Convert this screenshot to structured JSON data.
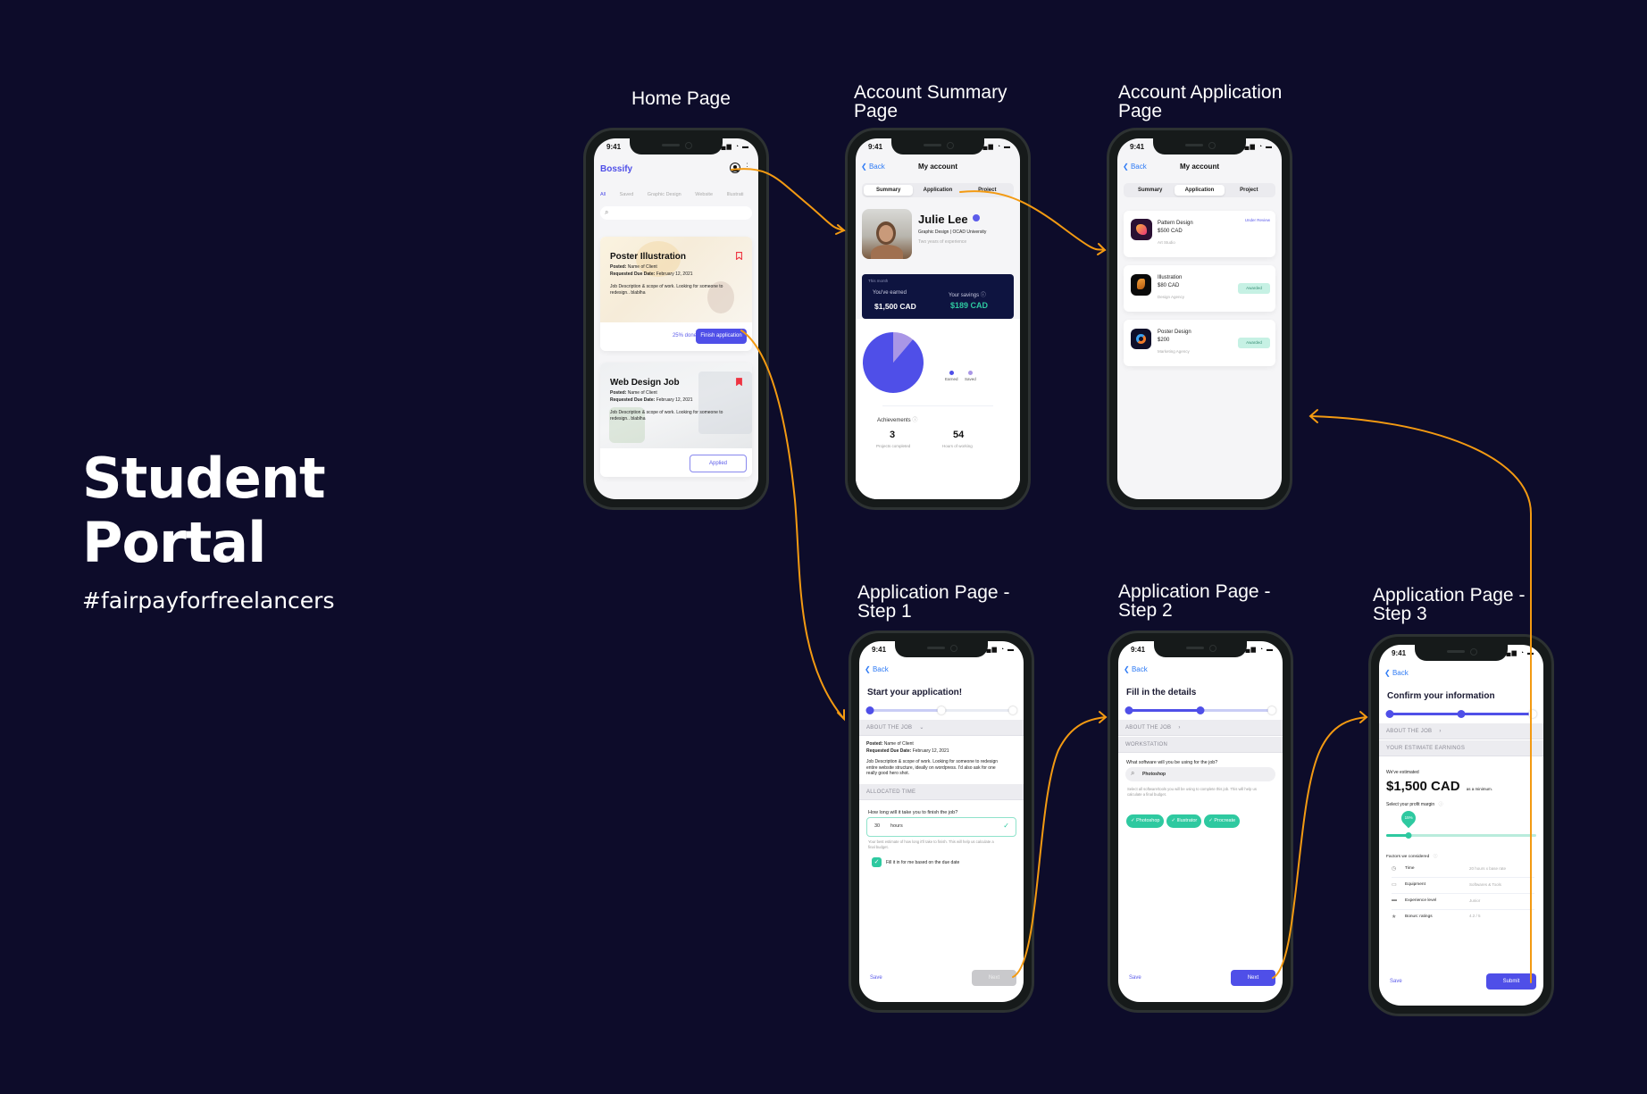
{
  "hero": {
    "title_line1": "Student",
    "title_line2": "Portal",
    "hashtag": "#fairpayforfreelancers"
  },
  "screen_titles": {
    "home": "Home Page",
    "summary_line1": "Account Summary",
    "summary_line2": "Page",
    "application_line1": "Account Application",
    "application_line2": "Page",
    "step1_line1": "Application Page -",
    "step1_line2": "Step 1",
    "step2_line1": "Application Page -",
    "step2_line2": "Step 2",
    "step3_line1": "Application Page -",
    "step3_line2": "Step 3"
  },
  "status_bar": {
    "time": "9:41",
    "icons": "signal-wifi-battery"
  },
  "colors": {
    "background": "#0d0c2a",
    "accent": "#4f4fe8",
    "teal": "#2ec9a0",
    "arrow": "#f39a12",
    "bookmark": "#ee3340"
  },
  "home": {
    "brand": "Bossify",
    "profile_icon": "user-circle-icon",
    "more_icon": "more-vertical-icon",
    "filters": [
      "All",
      "Saved",
      "Graphic Design",
      "Website",
      "Illustrati"
    ],
    "search_placeholder": "",
    "jobs": [
      {
        "title": "Poster Illustration",
        "posted_label": "Posted:",
        "posted_value": "Name of Client",
        "due_label": "Requested Due Date:",
        "due_value": "February 12, 2021",
        "description": "Job Description & scope of work. Looking for someone to redesign.. blablha",
        "bookmarked": false,
        "progress_text": "25% done",
        "action": "Finish application"
      },
      {
        "title": "Web Design Job",
        "posted_label": "Posted:",
        "posted_value": "Name of Client",
        "due_label": "Requested Due Date:",
        "due_value": "February 12, 2021",
        "description": "Job Description & scope of work. Looking for someone to redesign.. blablha",
        "bookmarked": true,
        "action": "Applied"
      }
    ]
  },
  "account": {
    "back": "Back",
    "title": "My account",
    "tabs": [
      "Summary",
      "Application",
      "Project"
    ]
  },
  "summary": {
    "name": "Julie Lee",
    "subtitle": "Graphic Design | OCAD University",
    "experience": "Two years of experience",
    "period": "This month",
    "earned_label": "You've earned",
    "earned_value": "$1,500 CAD",
    "savings_label": "Your savings",
    "savings_value": "$189 CAD",
    "legend": [
      "Earned",
      "Saved"
    ],
    "achievements_label": "Achievements",
    "projects_value": "3",
    "projects_label": "Projects completed",
    "hours_value": "54",
    "hours_label": "Hours of working"
  },
  "chart_data": {
    "type": "pie",
    "title": "",
    "categories": [
      "Earned",
      "Saved"
    ],
    "values": [
      1500,
      189
    ],
    "colors": [
      "#4f4fe8",
      "#a996e6"
    ],
    "legend": "right"
  },
  "applications": [
    {
      "title": "Pattern Design",
      "amount": "$500 CAD",
      "company": "Art Studio",
      "status": "Under Review",
      "status_type": "link"
    },
    {
      "title": "Illustration",
      "amount": "$80 CAD",
      "company": "Design Agency",
      "status": "Awarded",
      "status_type": "badge"
    },
    {
      "title": "Poster Design",
      "amount": "$200",
      "company": "Marketing Agency",
      "status": "Awarded",
      "status_type": "badge"
    }
  ],
  "step1": {
    "back": "Back",
    "heading": "Start your application!",
    "progress_step": 1,
    "progress_total": 3,
    "section_about": "ABOUT THE JOB",
    "posted_label": "Posted:",
    "posted_value": "Name of Client",
    "due_label": "Requested Due Date:",
    "due_value": "February 12, 2021",
    "description": "Job Description & scope of work. Looking for someone to redesign entire website structure, ideally on wordpress. I'd also ask for one really good hero shot.",
    "section_time": "ALLOCATED TIME",
    "question": "How long will it take you to finish the job?",
    "hours_value": "30",
    "hours_unit": "hours",
    "helper": "Your best estimate of how long it'll take to finish. This will help us calculate a final budget.",
    "checkbox_label": "Fill it in for me based on the due date",
    "checkbox_checked": true,
    "save": "Save",
    "next": "Next"
  },
  "step2": {
    "back": "Back",
    "heading": "Fill in the details",
    "progress_step": 2,
    "progress_total": 3,
    "section_about": "ABOUT THE JOB",
    "section_workstation": "WORKSTATION",
    "question": "What software will you be using for the job?",
    "search_value": "Photoshop",
    "helper": "Select all software/tools you will be using to complete this job. This will help us calculate a final budget.",
    "chips": [
      "Photoshop",
      "Illustrator",
      "Procreate"
    ],
    "save": "Save",
    "next": "Next"
  },
  "step3": {
    "back": "Back",
    "heading": "Confirm your information",
    "progress_step": 3,
    "progress_total": 3,
    "section_about": "ABOUT THE JOB",
    "section_earnings": "YOUR ESTIMATE EARNINGS",
    "estimate_label": "We've estimated",
    "estimate_value": "$1,500 CAD",
    "estimate_suffix": "as a minimum.",
    "margin_label": "Select your profit margin",
    "margin_value": "15%",
    "margin_fraction": 0.15,
    "factors_label": "Factors we considered",
    "factors": [
      {
        "icon": "clock-icon",
        "name": "Time",
        "value": "20 hours x base rate"
      },
      {
        "icon": "monitor-icon",
        "name": "Equipment",
        "value": "Softwares & Tools"
      },
      {
        "icon": "id-card-icon",
        "name": "Experience level",
        "value": "Junior"
      },
      {
        "icon": "star-icon",
        "name": "Bonus: ratings",
        "value": "4.2 / 5"
      }
    ],
    "save": "Save",
    "submit": "Submit"
  }
}
